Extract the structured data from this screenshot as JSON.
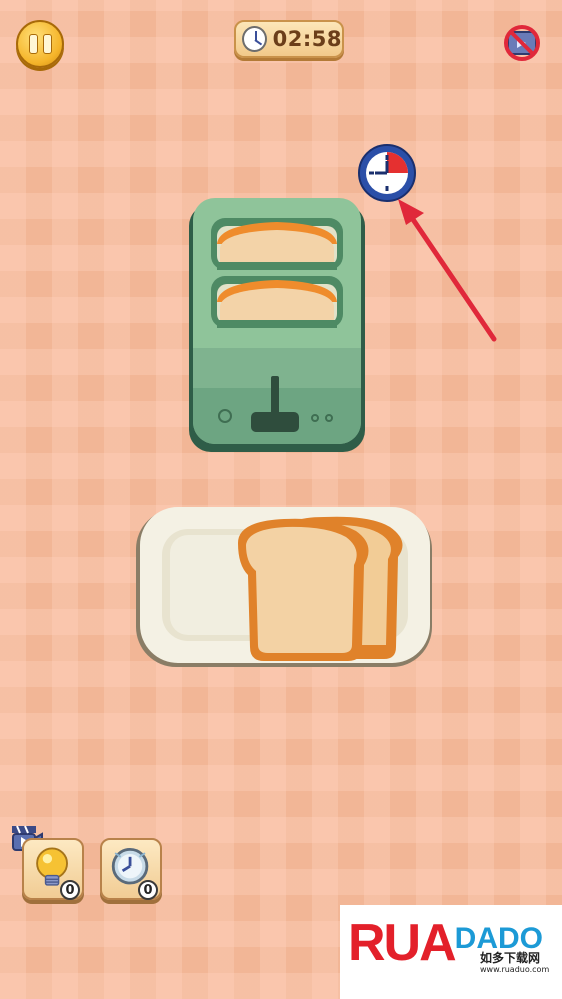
{
  "hud": {
    "timer_text": "02:58"
  },
  "icons": {
    "pause": "pause-icon",
    "timer_clock": "clock-icon",
    "no_ads": "no-ads-icon",
    "freeze_clock": "clock-icon",
    "hint_bulb": "lightbulb-icon",
    "video": "video-camera-icon"
  },
  "powerups": {
    "hint_count": "0",
    "freeze_count": "0"
  },
  "watermark": {
    "logo_main": "RUA",
    "logo_accent": "DADO",
    "chinese": "如多下载网",
    "url": "www.ruaduo.com"
  },
  "colors": {
    "background": "#f2b696",
    "toaster": "#8fc49a",
    "arrow": "#e0283a",
    "timer_text": "#6b3e1a"
  }
}
